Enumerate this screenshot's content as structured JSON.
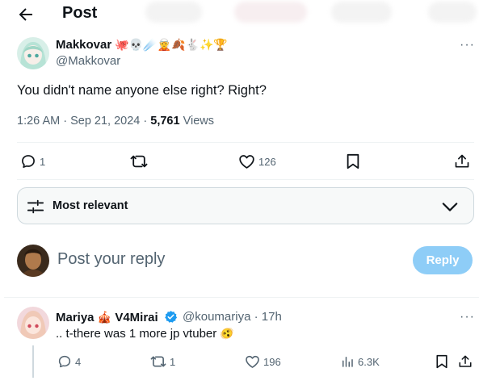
{
  "header": {
    "title": "Post"
  },
  "post": {
    "author_name": "Makkovar",
    "author_emojis": "🐙💀☄️🧝🍂🐇✨🏆",
    "handle": "@Makkovar",
    "text": "You didn't name anyone else right? Right?",
    "timestamp": "1:26 AM · Sep 21, 2024 · ",
    "views_count": "5,761",
    "views_label": " Views",
    "replies": "1",
    "likes": "126",
    "more": "···"
  },
  "sort": {
    "label": "Most relevant"
  },
  "composer": {
    "placeholder": "Post your reply",
    "button_label": "Reply"
  },
  "reply": {
    "author_name": "Mariya",
    "author_emoji": "🎪",
    "author_suffix": "V4Mirai",
    "handle": "@koumariya",
    "time": "· 17h",
    "text": ".. t-there was 1 more jp vtuber",
    "text_emoji": "🫨",
    "replies": "4",
    "reposts": "1",
    "likes": "196",
    "views": "6.3K",
    "more": "···"
  },
  "colors": {
    "accent": "#1d9bf0",
    "reply_button": "#8ecdf7",
    "muted": "#536471"
  }
}
